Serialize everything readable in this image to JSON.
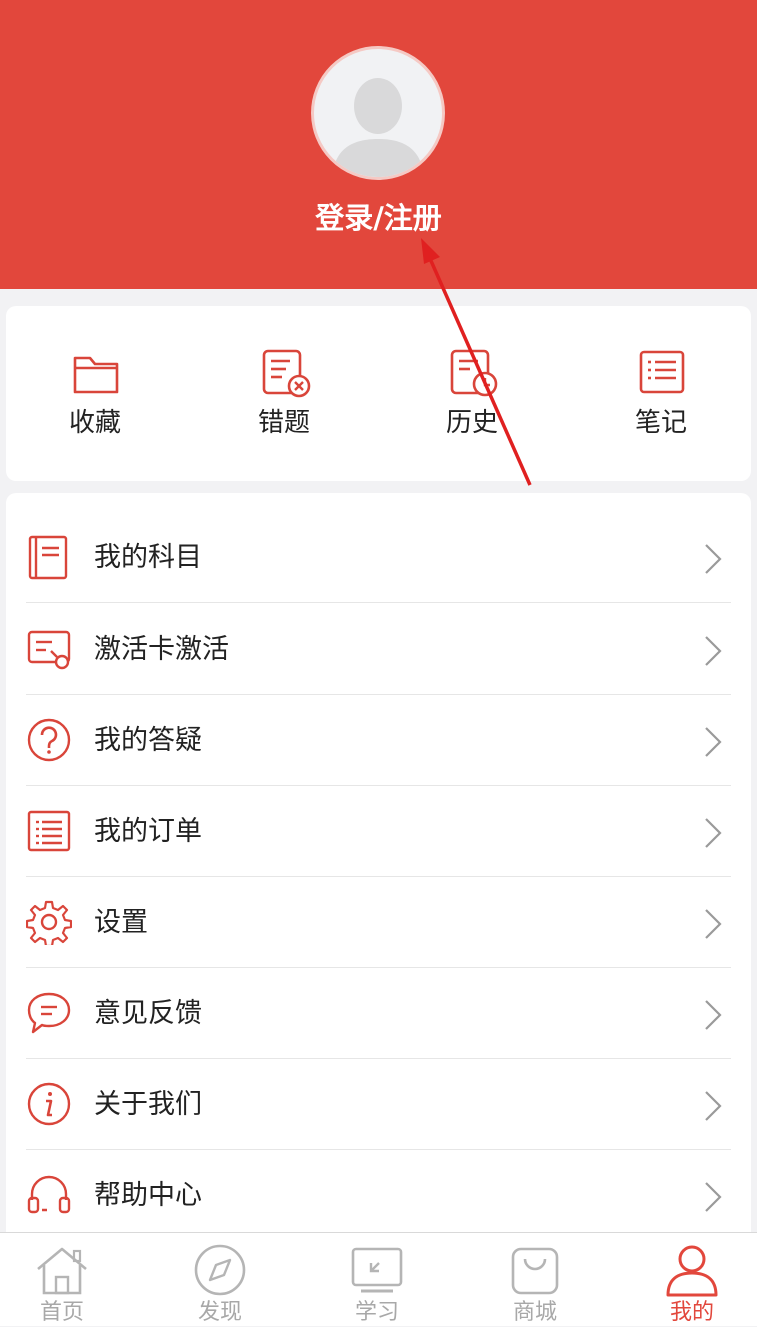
{
  "profile": {
    "login_label": "登录/注册"
  },
  "quick_actions": [
    {
      "label": "收藏",
      "icon": "folder-icon"
    },
    {
      "label": "错题",
      "icon": "wrong-question-icon"
    },
    {
      "label": "历史",
      "icon": "history-icon"
    },
    {
      "label": "笔记",
      "icon": "notes-icon"
    }
  ],
  "menu": [
    {
      "label": "我的科目",
      "icon": "subject-book-icon"
    },
    {
      "label": "激活卡激活",
      "icon": "activation-card-icon"
    },
    {
      "label": "我的答疑",
      "icon": "question-circle-icon"
    },
    {
      "label": "我的订单",
      "icon": "order-list-icon"
    },
    {
      "label": "设置",
      "icon": "gear-icon"
    },
    {
      "label": "意见反馈",
      "icon": "feedback-chat-icon"
    },
    {
      "label": "关于我们",
      "icon": "info-icon"
    },
    {
      "label": "帮助中心",
      "icon": "headset-icon"
    }
  ],
  "tabbar": {
    "items": [
      {
        "label": "首页",
        "icon": "home-icon"
      },
      {
        "label": "发现",
        "icon": "compass-icon"
      },
      {
        "label": "学习",
        "icon": "study-screen-icon"
      },
      {
        "label": "商城",
        "icon": "shopping-bag-icon"
      },
      {
        "label": "我的",
        "icon": "user-profile-icon"
      }
    ],
    "active_label": "我的"
  },
  "colors": {
    "accent": "#e2473c",
    "inactive": "#a8a8a8",
    "background": "#f2f2f4"
  }
}
